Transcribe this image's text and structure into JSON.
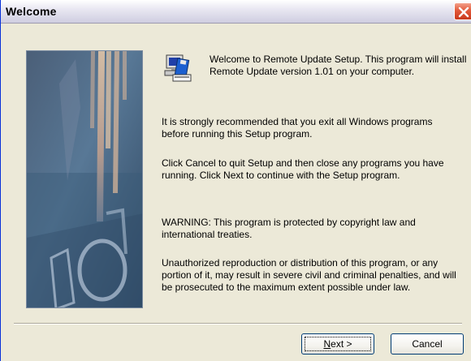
{
  "window": {
    "title": "Welcome"
  },
  "sidepanel": {
    "watermark_text": "10"
  },
  "content": {
    "welcome": "Welcome to Remote Update Setup. This program will install Remote Update version 1.01 on your computer.",
    "recommend": "It is strongly recommended that you exit all Windows programs before running this Setup program.",
    "cancel_note": "Click Cancel to quit Setup and then close any programs you have running.  Click Next to continue with the Setup program.",
    "warning": "WARNING: This program is protected by copyright law and international treaties.",
    "unauthorized": "Unauthorized reproduction or distribution of this program, or any portion of it, may result in severe civil and criminal penalties, and will be prosecuted to the maximum extent possible under law."
  },
  "buttons": {
    "next_mnemonic": "N",
    "next_rest": "ext >",
    "cancel": "Cancel"
  },
  "icons": {
    "close": "close-icon",
    "setup": "setup-computer-icon"
  },
  "colors": {
    "dialog_bg": "#ece9d8",
    "close_red": "#e2593a",
    "button_border": "#003c74"
  }
}
